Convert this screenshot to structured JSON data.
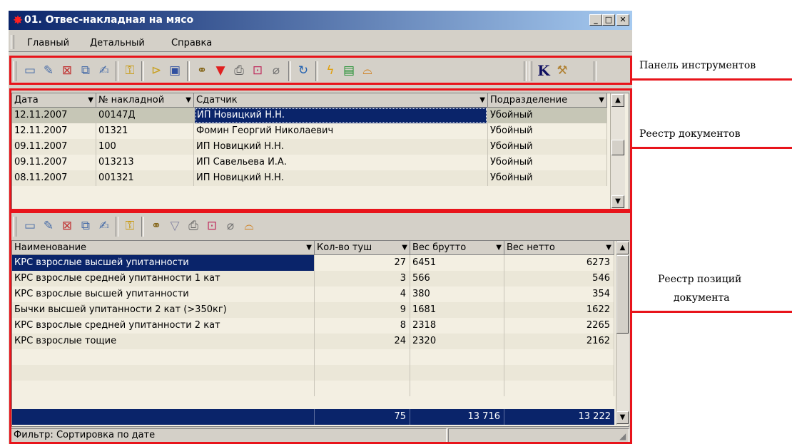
{
  "window": {
    "title": "01. Отвес-накладная на мясо",
    "min_label": "_",
    "max_label": "□",
    "close_label": "✕",
    "app_icon": "star-icon"
  },
  "menu": [
    "Главный",
    "Детальный",
    "Справка"
  ],
  "toolbar_icons": [
    "new-icon",
    "edit-icon",
    "delete-icon",
    "copy-icon",
    "edit-doc-icon",
    "lock-icon",
    "open-icon",
    "save-icon",
    "find-icon",
    "filter-icon",
    "print-icon",
    "export-icon",
    "attach-icon",
    "refresh-icon",
    "run-icon",
    "report-icon",
    "book-icon",
    "k-icon",
    "magic-icon"
  ],
  "documents": {
    "columns": [
      "Дата",
      "№ накладной",
      "Сдатчик",
      "Подразделение"
    ],
    "rows": [
      [
        "12.11.2007",
        "00147Д",
        "ИП Новицкий Н.Н.",
        "Убойный"
      ],
      [
        "12.11.2007",
        "01321",
        "Фомин Георгий  Николаевич",
        "Убойный"
      ],
      [
        "09.11.2007",
        "100",
        "ИП Новицкий Н.Н.",
        "Убойный"
      ],
      [
        "09.11.2007",
        "013213",
        "ИП Савельева И.А.",
        "Убойный"
      ],
      [
        "08.11.2007",
        "001321",
        "ИП Новицкий Н.Н.",
        "Убойный"
      ]
    ]
  },
  "positions": {
    "toolbar_icons": [
      "new-icon",
      "edit-icon",
      "delete-icon",
      "copy-icon",
      "edit-doc-icon",
      "lock-icon",
      "find-icon",
      "filter-icon",
      "print-icon",
      "export-icon",
      "attach-icon",
      "book-icon"
    ],
    "columns": [
      "Наименование",
      "Кол-во туш",
      "Вес брутто",
      "Вес нетто"
    ],
    "rows": [
      [
        "КРС взрослые высшей упитанности",
        "27",
        "6451",
        "6273"
      ],
      [
        "КРС взрослые средней упитанности 1 кат",
        "3",
        "566",
        "546"
      ],
      [
        "КРС взрослые высшей упитанности",
        "4",
        "380",
        "354"
      ],
      [
        "Бычки высшей упитанности 2 кат (>350кг)",
        "9",
        "1681",
        "1622"
      ],
      [
        "КРС взрослые средней упитанности 2 кат",
        "8",
        "2318",
        "2265"
      ],
      [
        "КРС взрослые тощие",
        "24",
        "2320",
        "2162"
      ]
    ],
    "totals": [
      "",
      "75",
      "13 716",
      "13 222"
    ]
  },
  "status": {
    "filter": "Фильтр: Сортировка по дате"
  },
  "annotations": {
    "toolbar": "Панель инструментов",
    "registry": "Реестр документов",
    "positions_line1": "Реестр позиций",
    "positions_line2": "документа"
  },
  "colors": {
    "highlight": "#e8141b",
    "selection": "#0a246a",
    "grid_bg": "#f3efe2"
  }
}
